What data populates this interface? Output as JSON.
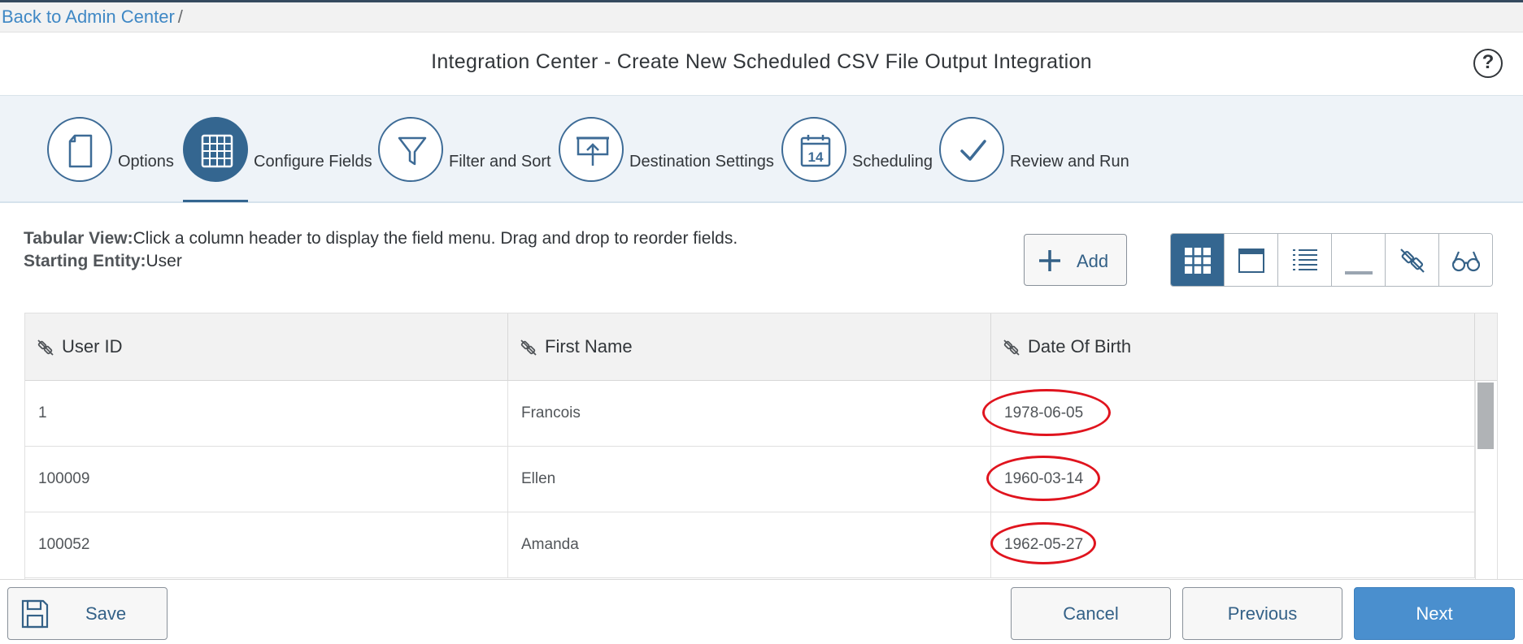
{
  "breadcrumb": {
    "back_link": "Back to Admin Center",
    "separator": "/"
  },
  "header": {
    "title": "Integration Center - Create New Scheduled CSV File Output Integration",
    "help_icon": "?"
  },
  "wizard": {
    "steps": [
      {
        "label": "Options",
        "icon": "document-icon",
        "active": false
      },
      {
        "label": "Configure Fields",
        "icon": "grid-icon",
        "active": true
      },
      {
        "label": "Filter and Sort",
        "icon": "funnel-icon",
        "active": false
      },
      {
        "label": "Destination Settings",
        "icon": "upload-icon",
        "active": false
      },
      {
        "label": "Scheduling",
        "icon": "calendar-icon",
        "calendar_day": "14",
        "active": false
      },
      {
        "label": "Review and Run",
        "icon": "checkmark-icon",
        "active": false
      }
    ]
  },
  "info": {
    "tabular_label": "Tabular View:",
    "tabular_text": "Click a column header to display the field menu. Drag and drop to reorder fields.",
    "entity_label": "Starting Entity:",
    "entity_value": "User"
  },
  "toolbar": {
    "add_label": "Add",
    "views": [
      "grid-view-icon",
      "panel-view-icon",
      "list-view-icon",
      "minimize-view-icon",
      "unlink-view-icon",
      "preview-glasses-icon"
    ],
    "active_view": "grid-view-icon"
  },
  "table": {
    "columns": [
      "User ID",
      "First Name",
      "Date Of Birth"
    ],
    "rows": [
      [
        "1",
        "Francois",
        "1978-06-05"
      ],
      [
        "100009",
        "Ellen",
        "1960-03-14"
      ],
      [
        "100052",
        "Amanda",
        "1962-05-27"
      ]
    ]
  },
  "footer": {
    "save": "Save",
    "cancel": "Cancel",
    "previous": "Previous",
    "next": "Next"
  },
  "colors": {
    "primary": "#346690",
    "link": "#3f88c5",
    "next_button": "#4a8fce",
    "highlight": "#e0141e",
    "wizard_bg": "#eef3f8"
  }
}
